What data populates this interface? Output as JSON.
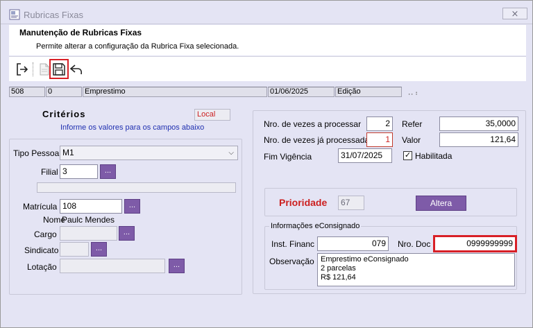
{
  "window": {
    "title": "Rubricas Fixas",
    "close_symbol": "⨯"
  },
  "header": {
    "title": "Manutenção de Rubricas Fixas",
    "subtitle": "Permite alterar a configuração da Rubrica Fixa selecionada."
  },
  "status": {
    "code": "508",
    "zero": "0",
    "name": "Emprestimo",
    "date": "01/06/2025",
    "mode": "Edição",
    "grip": "⠠⠄⠆"
  },
  "criteria": {
    "title": "Critérios",
    "hint": "Informe os valores para os campos abaixo",
    "local_badge": "Local",
    "tipo_pessoa_label": "Tipo Pessoa",
    "tipo_pessoa_value": "M1",
    "filial_label": "Filial",
    "filial_value": "3",
    "matricula_label": "Matrícula",
    "matricula_value": "108",
    "nome_label": "Nome",
    "nome_value": "Paulc Mendes",
    "cargo_label": "Cargo",
    "cargo_value": "",
    "sindicato_label": "Sindicato",
    "sindicato_value": "",
    "lotacao_label": "Lotação",
    "lotacao_value": "",
    "lookup_label": "..."
  },
  "details": {
    "vezes_processar_label": "Nro. de vezes a processar",
    "vezes_processar_value": "2",
    "vezes_processadas_label": "Nro. de vezes já processadas",
    "vezes_processadas_value": "1",
    "fim_vigencia_label": "Fim Vigência",
    "fim_vigencia_value": "31/07/2025",
    "refer_label": "Refer",
    "refer_value": "35,0000",
    "valor_label": "Valor",
    "valor_value": "121,64",
    "habilitada_label": "Habilitada",
    "habilitada_checked": "✓"
  },
  "prioridade": {
    "label": "Prioridade",
    "value": "67",
    "button_label": "Altera"
  },
  "econsignado": {
    "title": "Informações eConsignado",
    "inst_financ_label": "Inst. Financ",
    "inst_financ_value": "079",
    "nro_doc_label": "Nro. Doc",
    "nro_doc_value": "0999999999",
    "observacao_label": "Observação",
    "observacao_line1": "Emprestimo eConsignado",
    "observacao_line2": "2 parcelas",
    "observacao_line3": "R$ 121,64"
  },
  "colors": {
    "accent_button": "#7e5ba8",
    "highlight": "#d81f26",
    "priority_text": "#cc1f1f",
    "hint_text": "#1f2fb0"
  }
}
